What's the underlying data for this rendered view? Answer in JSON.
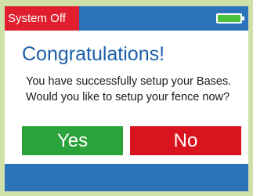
{
  "status": {
    "label": "System Off",
    "battery_icon": "battery-full-icon",
    "battery_color": "#4ac23d"
  },
  "dialog": {
    "title": "Congratulations!",
    "message": "You have successfully setup your Bases. Would you like to setup your fence now?",
    "yes_label": "Yes",
    "no_label": "No"
  },
  "colors": {
    "header": "#2c73ba",
    "status_off": "#e01e2d",
    "title": "#1c5fa8",
    "yes": "#2aa33a",
    "no": "#d9141e"
  }
}
